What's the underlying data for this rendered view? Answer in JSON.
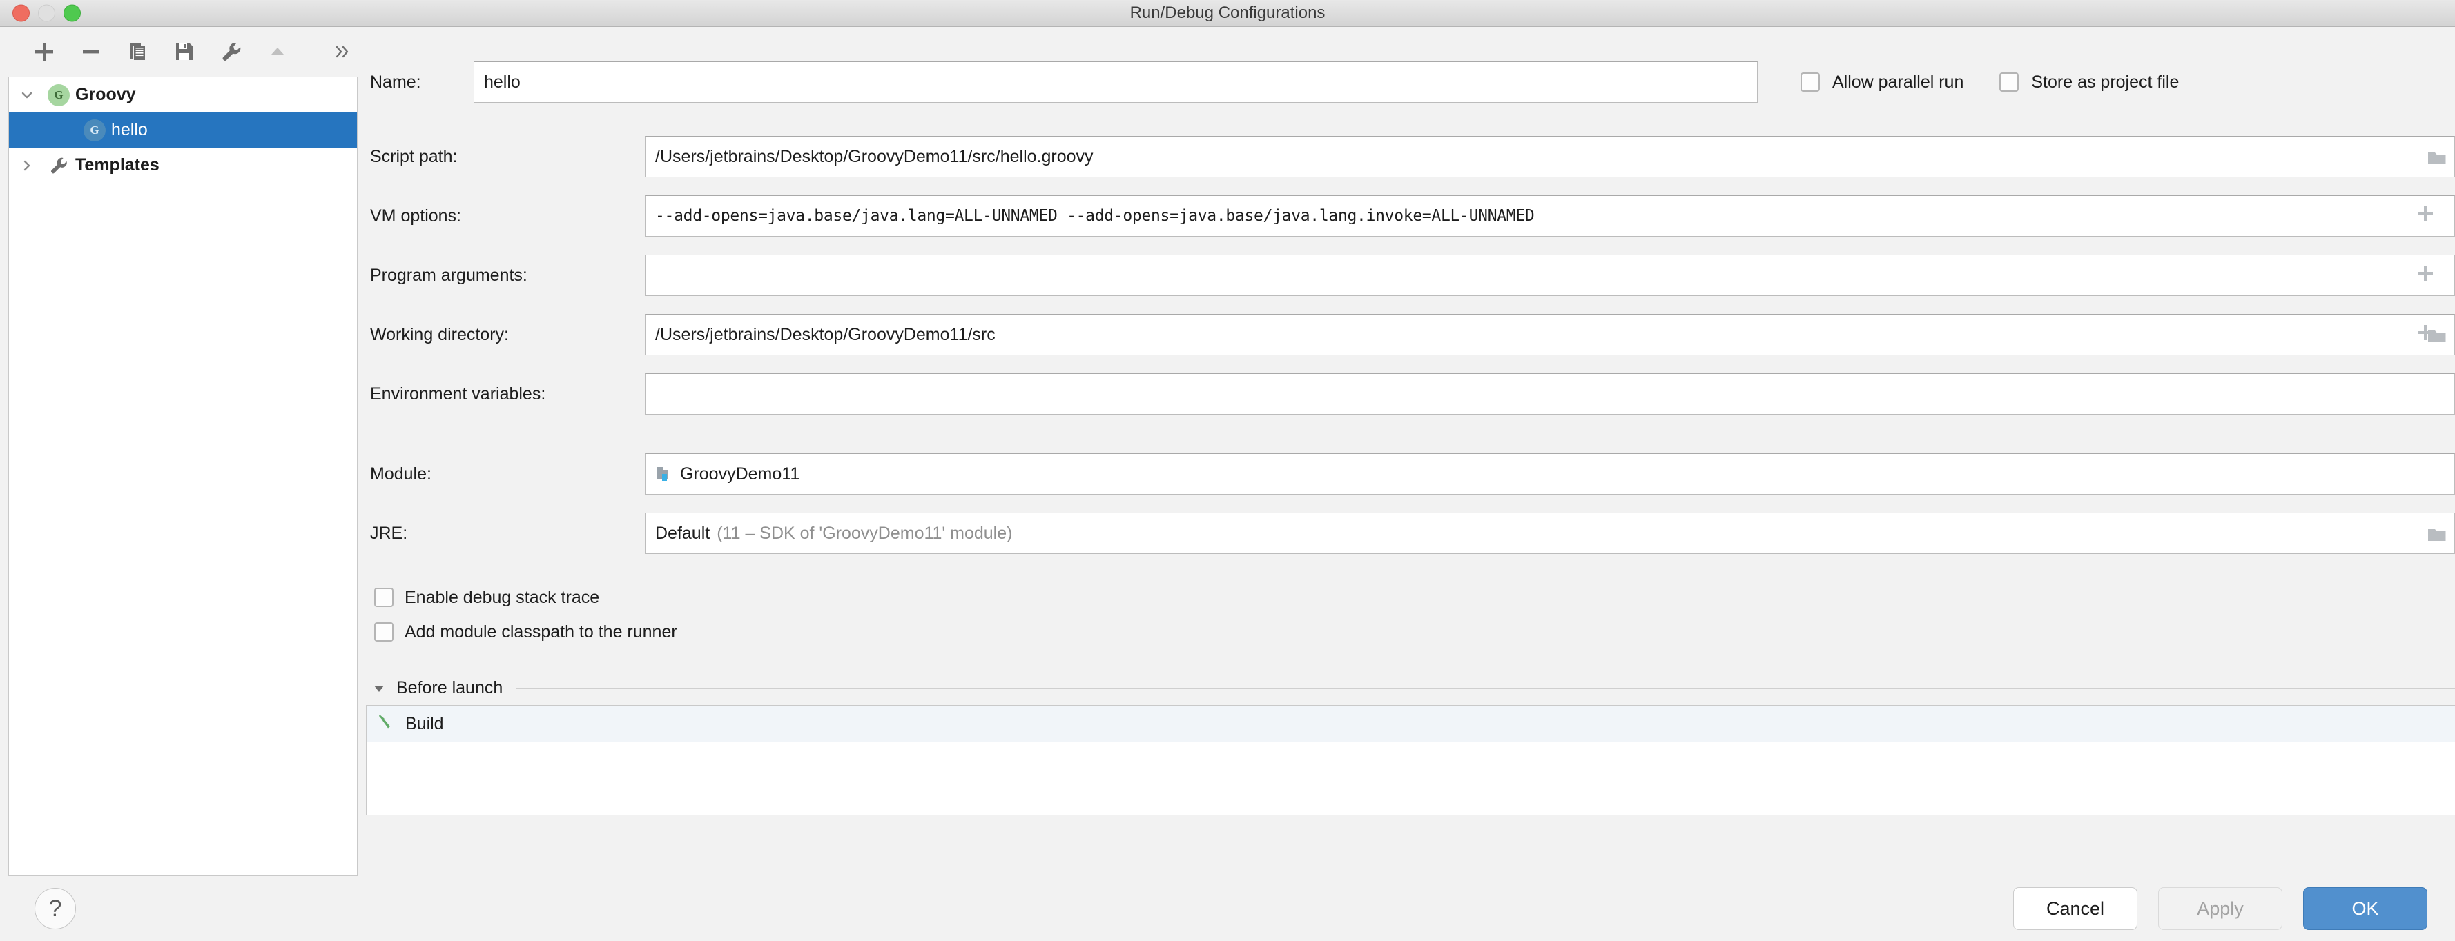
{
  "window": {
    "title": "Run/Debug Configurations",
    "traffic_lights": [
      "close-button",
      "minimize-button",
      "zoom-button"
    ]
  },
  "tree_toolbar": {
    "buttons": [
      {
        "name": "add-configuration-button",
        "icon": "plus-icon"
      },
      {
        "name": "remove-configuration-button",
        "icon": "minus-icon"
      },
      {
        "name": "copy-configuration-button",
        "icon": "copy-icon"
      },
      {
        "name": "save-configuration-button",
        "icon": "save-icon"
      },
      {
        "name": "edit-templates-button",
        "icon": "wrench-icon"
      },
      {
        "name": "move-up-button",
        "icon": "triangle-up-icon"
      },
      {
        "name": "more-options-button",
        "icon": "chevron-double-right-icon"
      }
    ],
    "more_label": "››"
  },
  "tree": {
    "items": [
      {
        "label": "Groovy",
        "level": 0,
        "expanded": true,
        "selected": false,
        "icon": "groovy-icon",
        "badge": "G"
      },
      {
        "label": "hello",
        "level": 1,
        "expanded": null,
        "selected": true,
        "icon": "groovy-script-icon",
        "badge": "G"
      },
      {
        "label": "Templates",
        "level": 0,
        "expanded": false,
        "selected": false,
        "icon": "wrench-icon",
        "badge": ""
      }
    ]
  },
  "form": {
    "name": {
      "label": "Name:",
      "value": "hello",
      "placeholder": ""
    },
    "allow_parallel_run": {
      "label": "Allow parallel run",
      "checked": false
    },
    "store_as_project_file": {
      "label": "Store as project file",
      "checked": false
    },
    "rows": [
      {
        "key": "script_path",
        "label": "Script path:",
        "value": "/Users/jetbrains/Desktop/GroovyDemo11/src/hello.groovy",
        "mono": false,
        "expand": false,
        "browse": true
      },
      {
        "key": "vm_options",
        "label": "VM options:",
        "value": "--add-opens=java.base/java.lang=ALL-UNNAMED  --add-opens=java.base/java.lang.invoke=ALL-UNNAMED",
        "mono": true,
        "expand": true,
        "browse": false
      },
      {
        "key": "program_arguments",
        "label": "Program arguments:",
        "value": "",
        "mono": false,
        "expand": true,
        "browse": false
      },
      {
        "key": "working_directory",
        "label": "Working directory:",
        "value": "/Users/jetbrains/Desktop/GroovyDemo11/src",
        "mono": false,
        "expand": true,
        "browse": true
      },
      {
        "key": "environment_variables",
        "label": "Environment variables:",
        "value": "",
        "mono": false,
        "expand": false,
        "browse": false
      }
    ],
    "module": {
      "label": "Module:",
      "value": "GroovyDemo11",
      "icon": "module-folder-icon"
    },
    "jre": {
      "label": "JRE:",
      "value": "Default",
      "hint": "(11 – SDK of 'GroovyDemo11' module)",
      "browse_icon": "folder-icon"
    },
    "checkboxes": [
      {
        "key": "enable_debug_stack_trace",
        "label": "Enable debug stack trace",
        "checked": false
      },
      {
        "key": "add_module_classpath",
        "label": "Add module classpath to the runner",
        "checked": false
      }
    ]
  },
  "before_launch": {
    "title": "Before launch",
    "expanded": true,
    "items": [
      {
        "label": "Build",
        "icon": "build-hammer-icon"
      }
    ]
  },
  "bottom": {
    "help_label": "?",
    "cancel_label": "Cancel",
    "apply_label": "Apply",
    "ok_label": "OK"
  },
  "colors": {
    "selection_blue": "#2675bf",
    "ok_button_blue": "#5190ce",
    "groovy_green": "#a6d6a0",
    "build_green": "#61ab68",
    "window_bg": "#f2f2f2"
  }
}
